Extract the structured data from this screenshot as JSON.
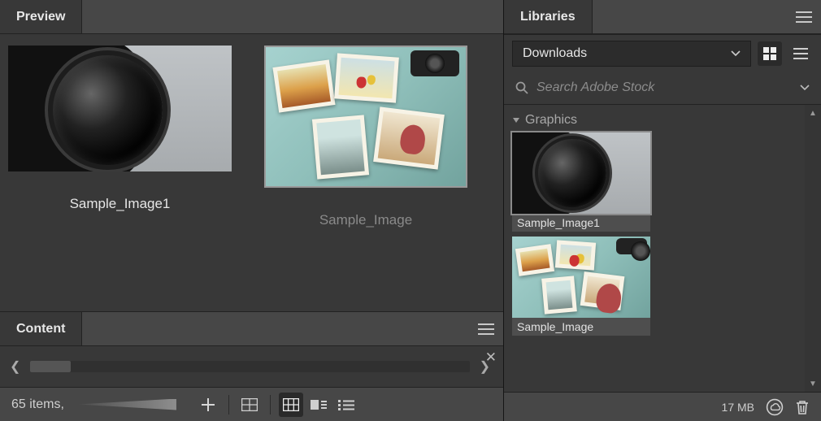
{
  "panels": {
    "preview": {
      "title": "Preview",
      "items": [
        {
          "caption": "Sample_Image1",
          "selected": true
        },
        {
          "caption": "Sample_Image",
          "selected": false
        }
      ]
    },
    "content": {
      "title": "Content",
      "footer": {
        "count_text": "65 items,"
      }
    },
    "libraries": {
      "title": "Libraries",
      "dropdown_selected": "Downloads",
      "search_placeholder": "Search Adobe Stock",
      "group_label": "Graphics",
      "items": [
        {
          "caption": "Sample_Image1"
        },
        {
          "caption": "Sample_Image"
        }
      ],
      "footer": {
        "size_text": "17 MB"
      }
    }
  }
}
